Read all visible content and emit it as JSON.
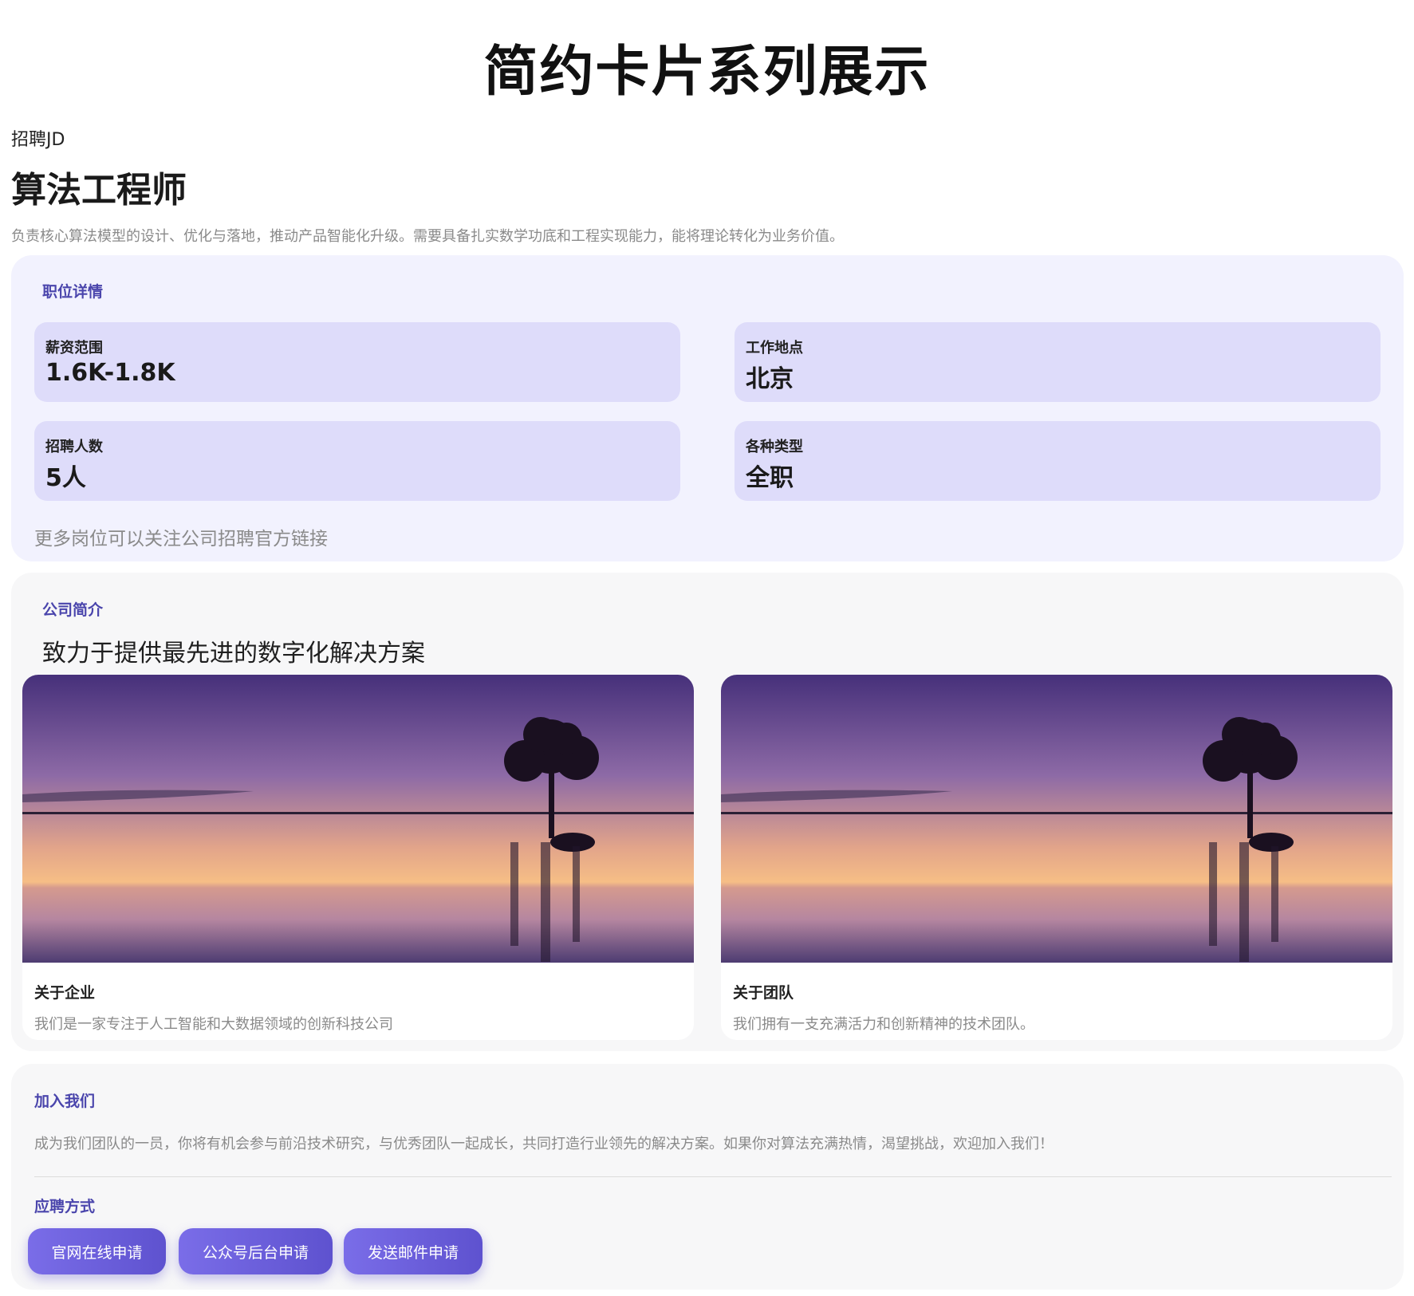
{
  "page": {
    "title": "简约卡片系列展示"
  },
  "job": {
    "eyebrow": "招聘JD",
    "title": "算法工程师",
    "description": "负责核心算法模型的设计、优化与落地，推动产品智能化升级。需要具备扎实数学功底和工程实现能力，能将理论转化为业务价值。"
  },
  "details": {
    "label": "职位详情",
    "items": [
      {
        "key": "薪资范围",
        "value": "1.6K-1.8K"
      },
      {
        "key": "工作地点",
        "value": "北京"
      },
      {
        "key": "招聘人数",
        "value": "5人"
      },
      {
        "key": "各种类型",
        "value": "全职"
      }
    ],
    "note": "更多岗位可以关注公司招聘官方链接"
  },
  "company": {
    "label": "公司简介",
    "headline": "致力于提供最先进的数字化解决方案",
    "cards": [
      {
        "title": "关于企业",
        "text": "我们是一家专注于人工智能和大数据领域的创新科技公司"
      },
      {
        "title": "关于团队",
        "text": "我们拥有一支充满活力和创新精神的技术团队。"
      }
    ]
  },
  "join": {
    "label": "加入我们",
    "text": "成为我们团队的一员，你将有机会参与前沿技术研究，与优秀团队一起成长，共同打造行业领先的解决方案。如果你对算法充满热情，渴望挑战，欢迎加入我们！",
    "apply_label": "应聘方式",
    "buttons": [
      "官网在线申请",
      "公众号后台申请",
      "发送邮件申请"
    ]
  },
  "colors": {
    "accent": "#4a45ac",
    "button_start": "#7a6de8",
    "button_end": "#5e52cf",
    "info_card": "#dedcfa",
    "details_panel": "#f2f2fe"
  }
}
